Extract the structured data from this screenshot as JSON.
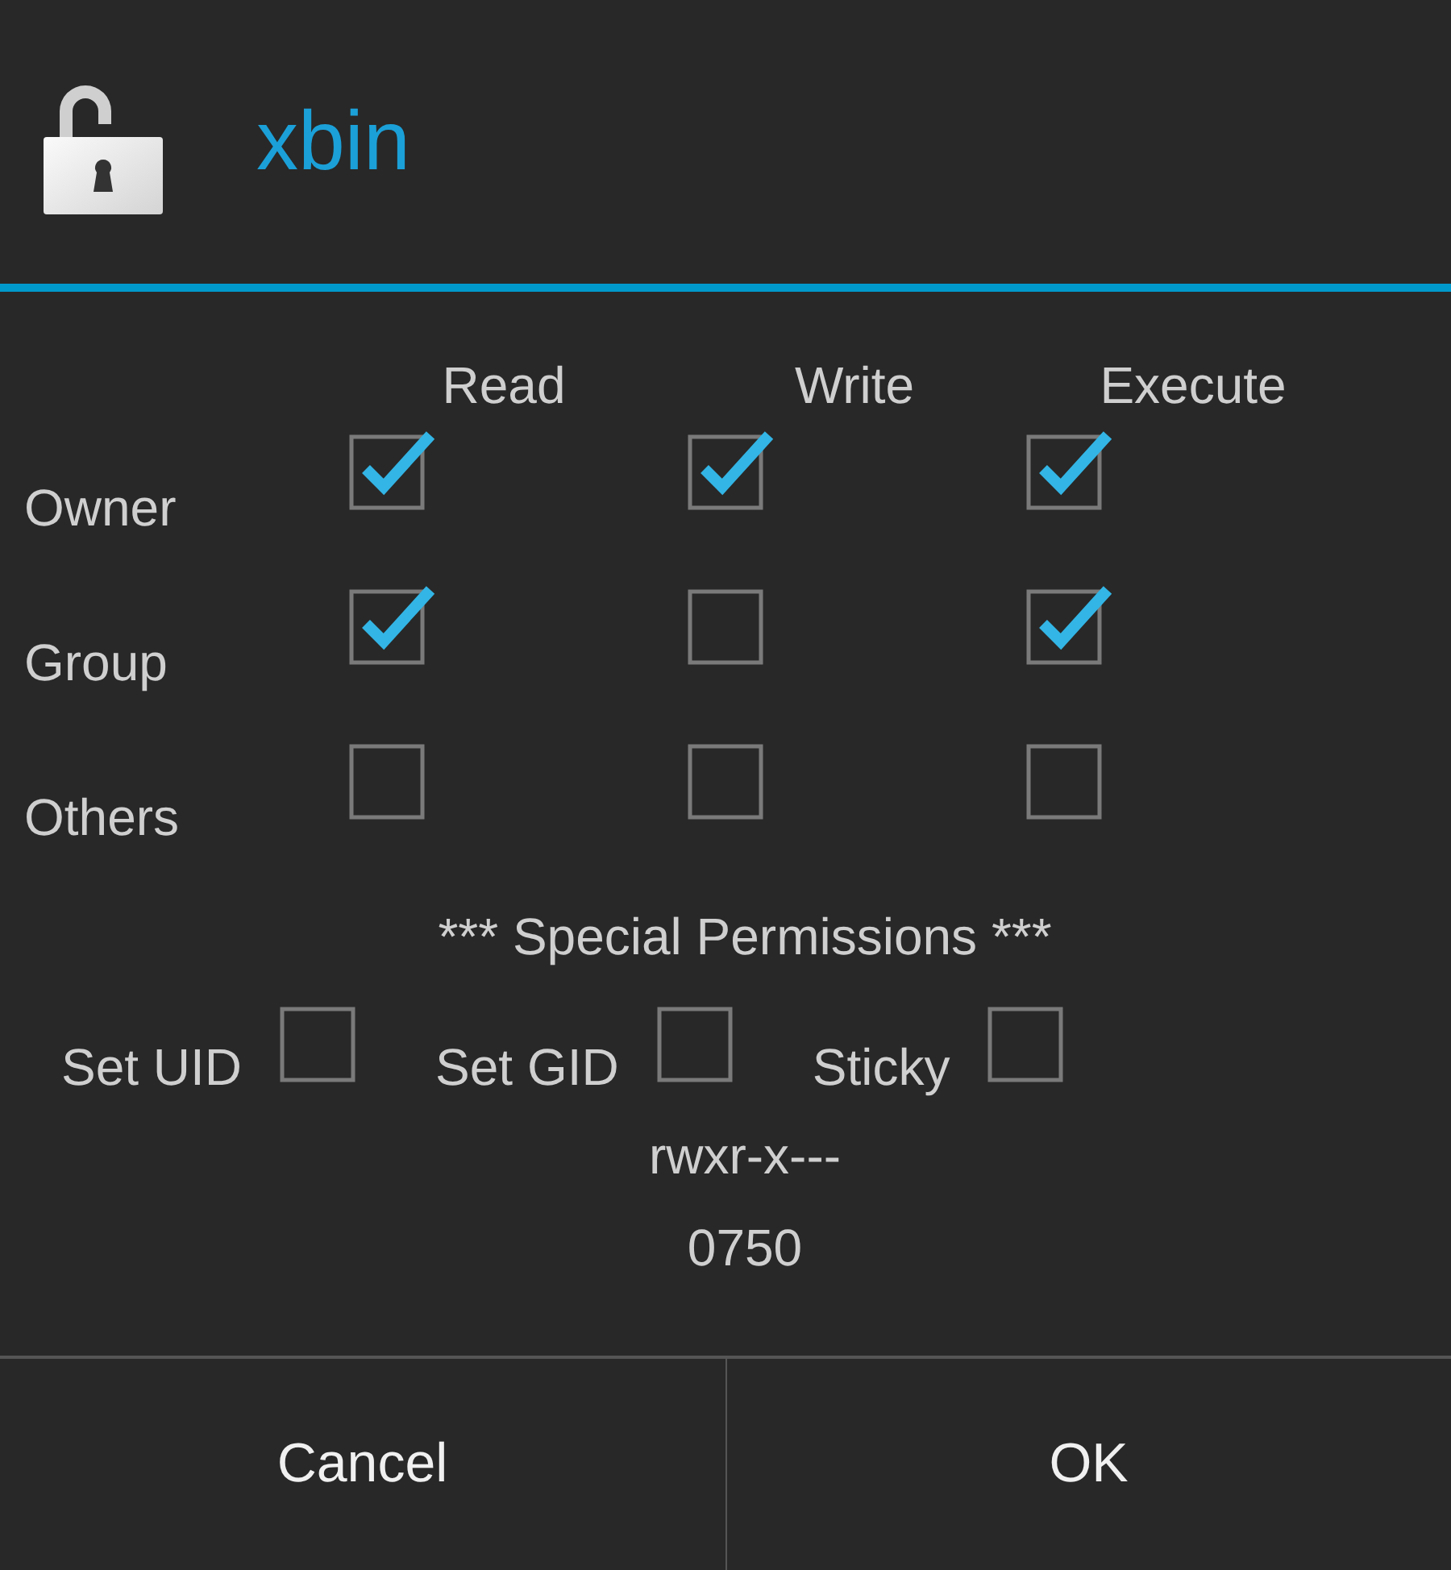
{
  "dialog": {
    "title": "xbin",
    "columns": [
      "Read",
      "Write",
      "Execute"
    ],
    "rows": [
      {
        "label": "Owner",
        "permissions": [
          {
            "checked": true
          },
          {
            "checked": true
          },
          {
            "checked": true
          }
        ]
      },
      {
        "label": "Group",
        "permissions": [
          {
            "checked": true
          },
          {
            "checked": false
          },
          {
            "checked": true
          }
        ]
      },
      {
        "label": "Others",
        "permissions": [
          {
            "checked": false
          },
          {
            "checked": false
          },
          {
            "checked": false
          }
        ]
      }
    ],
    "special_heading": "*** Special Permissions ***",
    "special": [
      {
        "label": "Set UID",
        "checked": false
      },
      {
        "label": "Set GID",
        "checked": false
      },
      {
        "label": "Sticky",
        "checked": false
      }
    ],
    "symbolic": "rwxr-x---",
    "octal": "0750",
    "buttons": [
      "Cancel",
      "OK"
    ]
  }
}
